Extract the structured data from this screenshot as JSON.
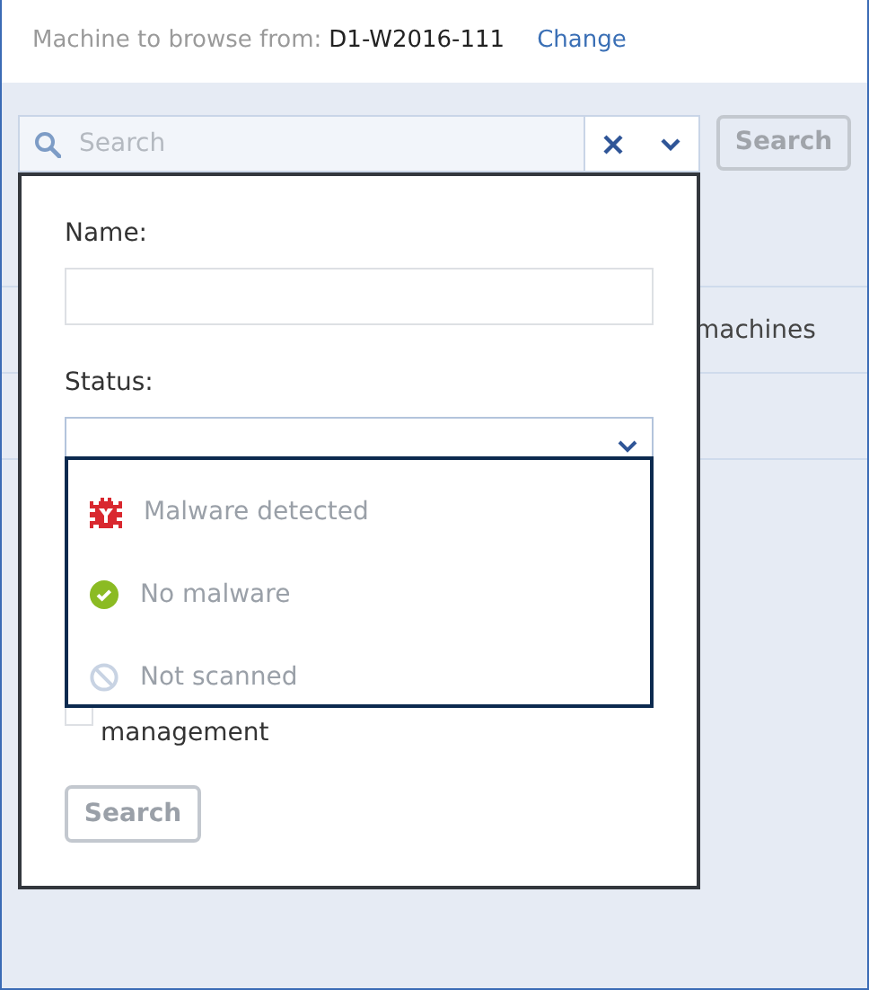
{
  "header": {
    "label": "Machine to browse from:",
    "machine": "D1-W2016-111",
    "link": "Change"
  },
  "search": {
    "placeholder": "Search",
    "button": "Search"
  },
  "background_list": {
    "rows": [
      {
        "text": ""
      },
      {
        "text": "machines"
      },
      {
        "text": ""
      }
    ]
  },
  "filter_panel": {
    "name_label": "Name:",
    "status_label": "Status:",
    "status_options": [
      {
        "kind": "malware",
        "label": "Malware detected"
      },
      {
        "kind": "clean",
        "label": "No malware"
      },
      {
        "kind": "unscanned",
        "label": "Not scanned"
      }
    ],
    "checkbox": {
      "label": "management",
      "checked": false
    },
    "button": "Search"
  }
}
